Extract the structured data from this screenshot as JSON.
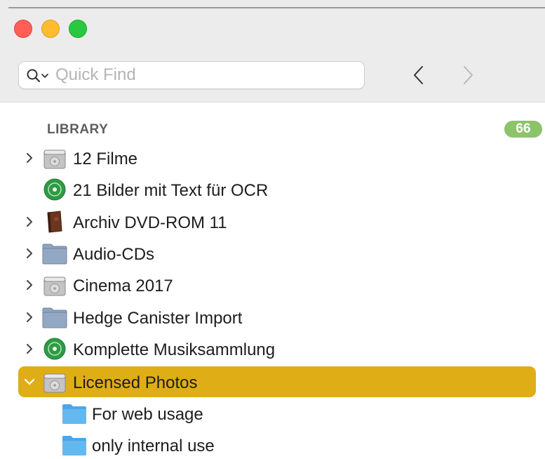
{
  "window": {
    "controls": [
      "close",
      "minimize",
      "zoom"
    ]
  },
  "search": {
    "placeholder": "Quick Find",
    "value": "",
    "icon": "magnifier-icon"
  },
  "nav": {
    "back_icon": "chevron-left-icon",
    "forward_icon": "chevron-right-icon"
  },
  "library": {
    "title": "LIBRARY",
    "count": "66",
    "count_color": "#8cc36b",
    "items": [
      {
        "label": "12 Filme",
        "icon": "hard-drive-icon",
        "expandable": true
      },
      {
        "label": "21 Bilder mit Text für OCR",
        "icon": "green-disc-icon",
        "expandable": false
      },
      {
        "label": "Archiv DVD-ROM 11",
        "icon": "book-icon",
        "expandable": true
      },
      {
        "label": "Audio-CDs",
        "icon": "gray-folder-icon",
        "expandable": true
      },
      {
        "label": "Cinema 2017",
        "icon": "hard-drive-icon",
        "expandable": true
      },
      {
        "label": "Hedge Canister Import",
        "icon": "gray-folder-icon",
        "expandable": true
      },
      {
        "label": "Komplette Musiksammlung",
        "icon": "green-disc-icon",
        "expandable": true
      },
      {
        "label": "Licensed Photos",
        "icon": "hard-drive-icon",
        "expandable": true,
        "expanded": true,
        "selected": true,
        "children": [
          {
            "label": "For web usage",
            "icon": "blue-folder-icon"
          },
          {
            "label": "only internal use",
            "icon": "blue-folder-icon"
          }
        ]
      }
    ]
  },
  "colors": {
    "selection": "#dfad16",
    "folder_blue": "#5fb4ee",
    "folder_gray": "#8fa4bd"
  }
}
